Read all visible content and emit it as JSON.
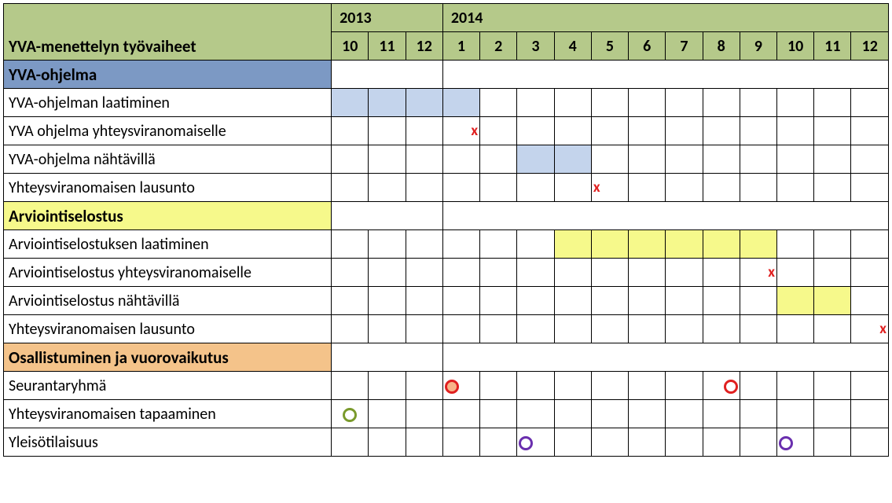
{
  "header": {
    "title": "YVA-menettelyn työvaiheet",
    "year_groups": [
      {
        "label": "2013",
        "months": [
          "10",
          "11",
          "12"
        ]
      },
      {
        "label": "2014",
        "months": [
          "1",
          "2",
          "3",
          "4",
          "5",
          "6",
          "7",
          "8",
          "9",
          "10",
          "11",
          "12"
        ]
      }
    ]
  },
  "sections": [
    {
      "id": "yva-ohjelma",
      "label": "YVA-ohjelma",
      "rows": [
        {
          "id": "laatiminen",
          "label": "YVA-ohjelman laatiminen"
        },
        {
          "id": "yhteys",
          "label": "YVA ohjelma yhteysviranomaiselle"
        },
        {
          "id": "nahtavilla",
          "label": "YVA-ohjelma nähtävillä"
        },
        {
          "id": "lausunto1",
          "label": "Yhteysviranomaisen lausunto"
        }
      ]
    },
    {
      "id": "arviointiselostus",
      "label": "Arviointiselostus",
      "rows": [
        {
          "id": "as-laatiminen",
          "label": "Arviointiselostuksen laatiminen"
        },
        {
          "id": "as-yhteys",
          "label": "Arviointiselostus yhteysviranomaiselle"
        },
        {
          "id": "as-nahtavilla",
          "label": "Arviointiselostus nähtävillä"
        },
        {
          "id": "lausunto2",
          "label": "Yhteysviranomaisen lausunto"
        }
      ]
    },
    {
      "id": "osallistuminen",
      "label": "Osallistuminen ja vuorovaikutus",
      "rows": [
        {
          "id": "seurantaryhma",
          "label": "Seurantaryhmä"
        },
        {
          "id": "tapaaminen",
          "label": "Yhteysviranomaisen tapaaminen"
        },
        {
          "id": "yleiso",
          "label": "Yleisötilaisuus"
        }
      ]
    }
  ],
  "marks": {
    "x": "x"
  },
  "chart_data": {
    "type": "table",
    "title": "YVA-menettelyn työvaiheet",
    "columns_year": [
      "2013",
      "2013",
      "2013",
      "2014",
      "2014",
      "2014",
      "2014",
      "2014",
      "2014",
      "2014",
      "2014",
      "2014",
      "2014",
      "2014",
      "2014"
    ],
    "columns_month": [
      10,
      11,
      12,
      1,
      2,
      3,
      4,
      5,
      6,
      7,
      8,
      9,
      10,
      11,
      12
    ],
    "legend": {
      "bar_blue": "YVA-ohjelma activity",
      "bar_yellow": "Arviointiselostus activity",
      "x": "milestone",
      "circle_red_filled": "Seurantaryhmä (held)",
      "circle_red_hollow": "Seurantaryhmä (planned)",
      "circle_green": "Yhteysviranomaisen tapaaminen",
      "circle_purple": "Yleisötilaisuus"
    },
    "rows": [
      {
        "section": "YVA-ohjelma",
        "task": "YVA-ohjelman laatiminen",
        "bars": [
          {
            "start": {
              "year": 2013,
              "month": 10
            },
            "end": {
              "year": 2014,
              "month": 1
            },
            "color": "blue"
          }
        ]
      },
      {
        "section": "YVA-ohjelma",
        "task": "YVA ohjelma yhteysviranomaiselle",
        "milestones": [
          {
            "year": 2014,
            "month": 1,
            "type": "x"
          }
        ]
      },
      {
        "section": "YVA-ohjelma",
        "task": "YVA-ohjelma nähtävillä",
        "bars": [
          {
            "start": {
              "year": 2014,
              "month": 3
            },
            "end": {
              "year": 2014,
              "month": 4
            },
            "color": "blue"
          }
        ]
      },
      {
        "section": "YVA-ohjelma",
        "task": "Yhteysviranomaisen lausunto",
        "milestones": [
          {
            "year": 2014,
            "month": 5,
            "type": "x"
          }
        ]
      },
      {
        "section": "Arviointiselostus",
        "task": "Arviointiselostuksen laatiminen",
        "bars": [
          {
            "start": {
              "year": 2014,
              "month": 4
            },
            "end": {
              "year": 2014,
              "month": 9
            },
            "color": "yellow"
          }
        ]
      },
      {
        "section": "Arviointiselostus",
        "task": "Arviointiselostus yhteysviranomaiselle",
        "milestones": [
          {
            "year": 2014,
            "month": 9,
            "type": "x"
          }
        ]
      },
      {
        "section": "Arviointiselostus",
        "task": "Arviointiselostus nähtävillä",
        "bars": [
          {
            "start": {
              "year": 2014,
              "month": 10
            },
            "end": {
              "year": 2014,
              "month": 11
            },
            "color": "yellow"
          }
        ]
      },
      {
        "section": "Arviointiselostus",
        "task": "Yhteysviranomaisen lausunto",
        "milestones": [
          {
            "year": 2014,
            "month": 12,
            "type": "x"
          }
        ]
      },
      {
        "section": "Osallistuminen ja vuorovaikutus",
        "task": "Seurantaryhmä",
        "milestones": [
          {
            "year": 2014,
            "month": 1,
            "type": "circle_red_filled"
          },
          {
            "year": 2014,
            "month": 8,
            "type": "circle_red_hollow"
          }
        ]
      },
      {
        "section": "Osallistuminen ja vuorovaikutus",
        "task": "Yhteysviranomaisen tapaaminen",
        "milestones": [
          {
            "year": 2013,
            "month": 10,
            "type": "circle_green"
          }
        ]
      },
      {
        "section": "Osallistuminen ja vuorovaikutus",
        "task": "Yleisötilaisuus",
        "milestones": [
          {
            "year": 2014,
            "month": 3,
            "type": "circle_purple"
          },
          {
            "year": 2014,
            "month": 10,
            "type": "circle_purple"
          }
        ]
      }
    ]
  }
}
